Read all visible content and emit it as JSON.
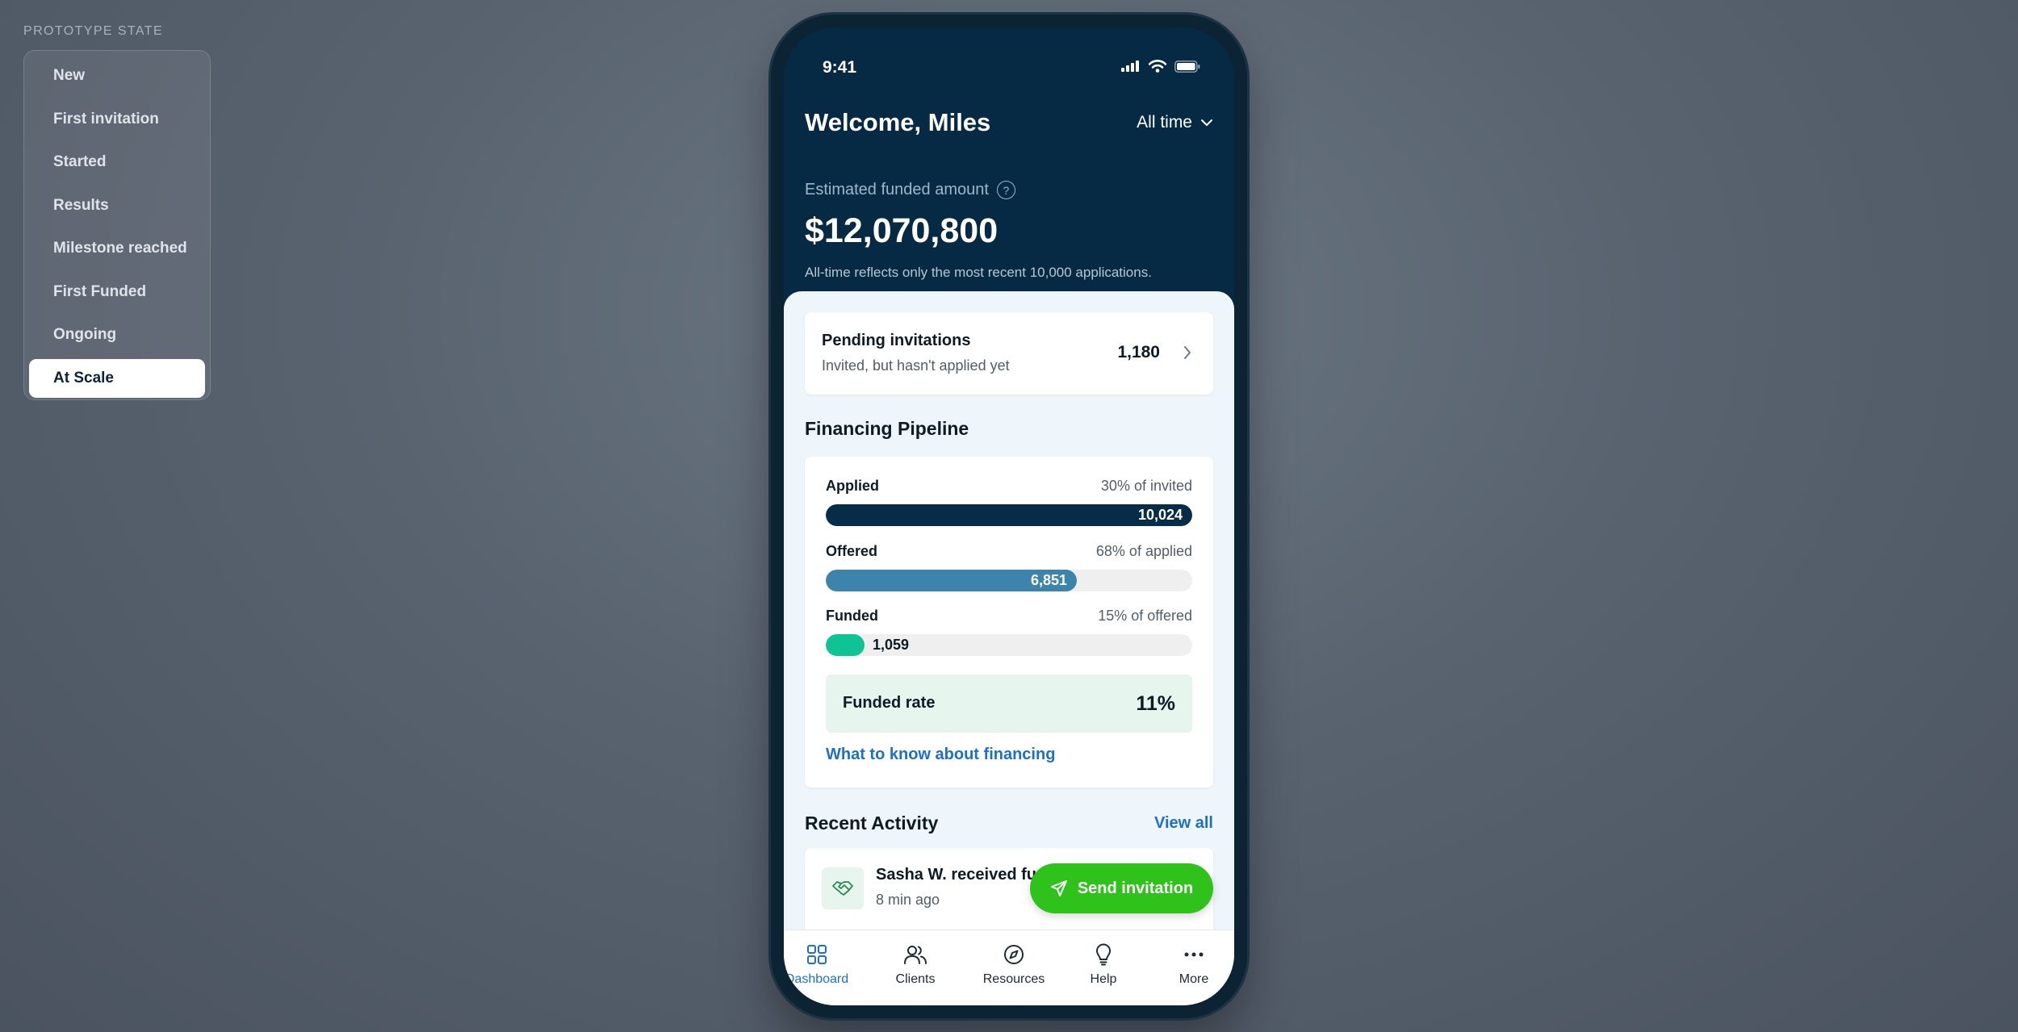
{
  "prototype": {
    "label": "PROTOTYPE STATE",
    "items": [
      {
        "label": "New",
        "active": false
      },
      {
        "label": "First invitation",
        "active": false
      },
      {
        "label": "Started",
        "active": false
      },
      {
        "label": "Results",
        "active": false
      },
      {
        "label": "Milestone reached",
        "active": false
      },
      {
        "label": "First Funded",
        "active": false
      },
      {
        "label": "Ongoing",
        "active": false
      },
      {
        "label": "At Scale",
        "active": true
      }
    ]
  },
  "status": {
    "time": "9:41"
  },
  "header": {
    "welcome": "Welcome, Miles",
    "filter": "All time",
    "estimated_label": "Estimated funded amount",
    "help_glyph": "?",
    "amount": "$12,070,800",
    "note": "All-time reflects only the most recent 10,000 applications."
  },
  "pending": {
    "title": "Pending invitations",
    "subtitle": "Invited, but hasn't applied yet",
    "count": "1,180"
  },
  "pipeline": {
    "title": "Financing Pipeline",
    "stages": [
      {
        "label": "Applied",
        "pct": "30% of invited",
        "value": "10,024",
        "fraction": 1.0,
        "color": "#062c48",
        "label_color": "#ffffff"
      },
      {
        "label": "Offered",
        "pct": "68% of applied",
        "value": "6,851",
        "fraction": 0.684,
        "color": "#3d84ad",
        "label_color": "#ffffff"
      },
      {
        "label": "Funded",
        "pct": "15% of offered",
        "value": "1,059",
        "fraction": 0.106,
        "color": "#0fc494",
        "label_color": "#0e1a24"
      }
    ],
    "rate_label": "Funded rate",
    "rate_value": "11%",
    "link": "What to know about financing"
  },
  "activity": {
    "title": "Recent Activity",
    "view_all": "View all",
    "item_title": "Sasha W.  received fu",
    "item_time": "8 min ago"
  },
  "fab": {
    "label": "Send invitation"
  },
  "tabs": [
    {
      "label": "Dashboard",
      "icon": "grid-icon",
      "active": true
    },
    {
      "label": "Clients",
      "icon": "users-icon",
      "active": false
    },
    {
      "label": "Resources",
      "icon": "compass-icon",
      "active": false
    },
    {
      "label": "Help",
      "icon": "lightbulb-icon",
      "active": false
    },
    {
      "label": "More",
      "icon": "more-icon",
      "active": false
    }
  ],
  "colors": {
    "header_bg": "#072a44",
    "accent_blue": "#1d6fc9",
    "fab_green": "#2fc21b"
  }
}
